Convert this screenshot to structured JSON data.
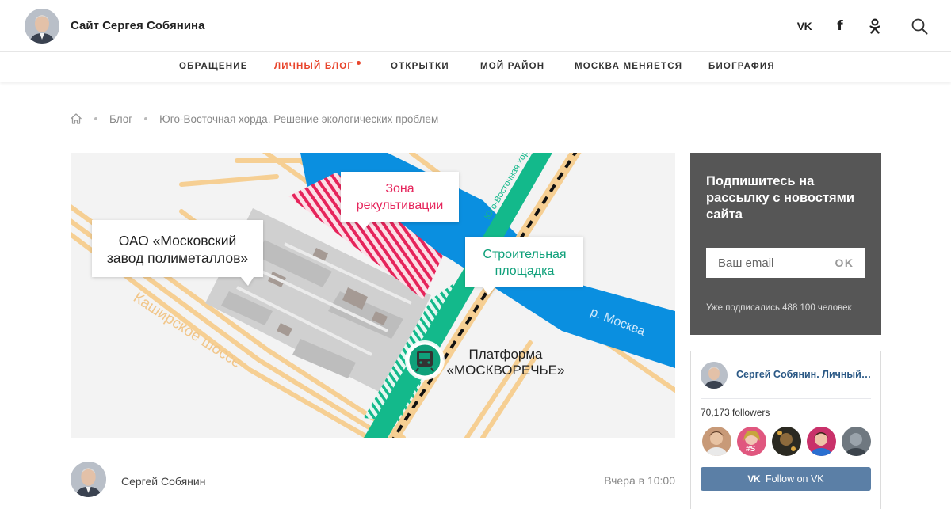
{
  "header": {
    "site_title": "Сайт Сергея Собянина",
    "social": [
      {
        "name": "vk",
        "icon": "vk-icon",
        "glyph": "VK"
      },
      {
        "name": "facebook",
        "icon": "facebook-icon",
        "glyph": "f"
      },
      {
        "name": "odnoklassniki",
        "icon": "odnoklassniki-icon"
      }
    ],
    "search_icon": "search-icon"
  },
  "nav": {
    "items": [
      {
        "label": "ОБРАЩЕНИЕ",
        "active": false
      },
      {
        "label": "ЛИЧНЫЙ БЛОГ",
        "active": true
      },
      {
        "label": "ОТКРЫТКИ",
        "active": false
      },
      {
        "label": "МОЙ РАЙОН",
        "active": false
      },
      {
        "label": "МОСКВА МЕНЯЕТСЯ",
        "active": false
      },
      {
        "label": "БИОГРАФИЯ",
        "active": false
      }
    ]
  },
  "breadcrumb": {
    "home_icon": "home-icon",
    "items": [
      "Блог",
      "Юго-Восточная хорда. Решение экологических проблем"
    ]
  },
  "map": {
    "labels": {
      "zone": [
        "Зона",
        "рекультивации"
      ],
      "factory": [
        "ОАО «Московский",
        "завод полиметаллов»"
      ],
      "construction": [
        "Строительная",
        "площадка"
      ],
      "platform": [
        "Платформа",
        "«МОСКВОРЕЧЬЕ»"
      ],
      "highway": "Каширское шоссе",
      "river": "р. Москва",
      "chord": "Юго-Восточная хорда"
    },
    "colors": {
      "river": "#0a8fe0",
      "rail_green": "#13b98b",
      "zone_red": "#e6245b",
      "roads": "#f6cf93",
      "factory": "#cfcfcf"
    }
  },
  "author": {
    "name": "Сергей Собянин",
    "time": "Вчера в 10:00"
  },
  "subscribe": {
    "title": "Подпишитесь на рассылку с новостями сайта",
    "placeholder": "Ваш email",
    "button": "OK",
    "count_text": "Уже подписались 488 100 человек"
  },
  "vk_widget": {
    "name": "Сергей Собянин. Личный блог",
    "followers": "70,173 followers",
    "follow_label": "Follow on VK",
    "follow_logo": "VK"
  },
  "colors": {
    "accent": "#e8452c",
    "subscribe_bg": "#565656",
    "vk_blue": "#5b7fa6",
    "vk_link": "#2a5885"
  }
}
